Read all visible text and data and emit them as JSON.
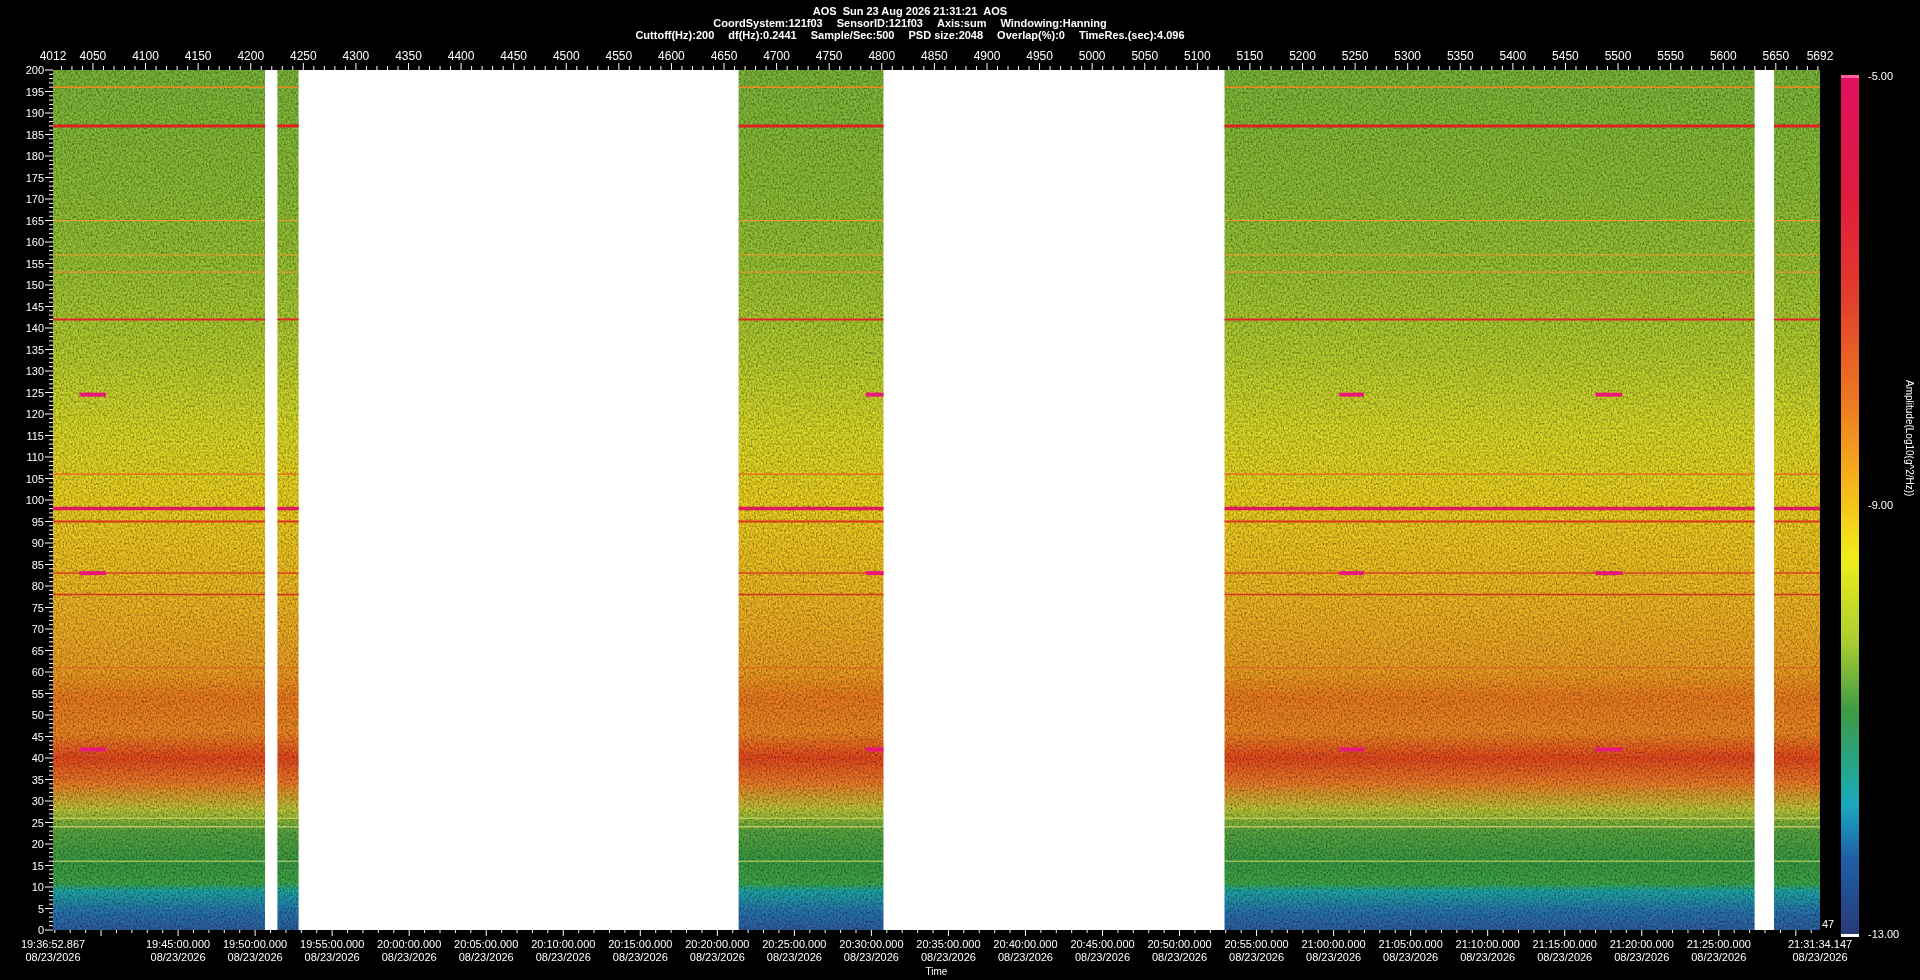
{
  "header": {
    "title": [
      "AOS",
      "Sun 23 Aug 2026 21:31:21",
      "AOS"
    ],
    "lines": [
      [
        "CoordSystem:121f03",
        "SensorID:121f03",
        "Axis:sum",
        "Windowing:Hanning"
      ],
      [
        "Cuttoff(Hz):200",
        "df(Hz):0.2441",
        "Sample/Sec:500",
        "PSD size:2048",
        "Overlap(%):0",
        "TimeRes.(sec):4.096"
      ]
    ]
  },
  "top_axis": {
    "ticks": [
      "4012",
      "4050",
      "4100",
      "4150",
      "4200",
      "4250",
      "4300",
      "4350",
      "4400",
      "4450",
      "4500",
      "4550",
      "4600",
      "4650",
      "4700",
      "4750",
      "4800",
      "4850",
      "4900",
      "4950",
      "5000",
      "5050",
      "5100",
      "5150",
      "5200",
      "5250",
      "5300",
      "5350",
      "5400",
      "5450",
      "5500",
      "5550",
      "5600",
      "5650",
      "5692"
    ]
  },
  "y_axis": {
    "ticks": [
      "200",
      "195",
      "190",
      "185",
      "180",
      "175",
      "170",
      "165",
      "160",
      "155",
      "150",
      "145",
      "140",
      "135",
      "130",
      "125",
      "120",
      "115",
      "110",
      "105",
      "100",
      "95",
      "90",
      "85",
      "80",
      "75",
      "70",
      "65",
      "60",
      "55",
      "50",
      "45",
      "40",
      "35",
      "30",
      "25",
      "20",
      "15",
      "10",
      "5",
      "0"
    ]
  },
  "x_axis": {
    "title": "Time",
    "ticks": [
      {
        "time": "19:36:52.867",
        "date": "08/23/2026"
      },
      {
        "time": "19:45:00.000",
        "date": "08/23/2026"
      },
      {
        "time": "19:50:00.000",
        "date": "08/23/2026"
      },
      {
        "time": "19:55:00.000",
        "date": "08/23/2026"
      },
      {
        "time": "20:00:00.000",
        "date": "08/23/2026"
      },
      {
        "time": "20:05:00.000",
        "date": "08/23/2026"
      },
      {
        "time": "20:10:00.000",
        "date": "08/23/2026"
      },
      {
        "time": "20:15:00.000",
        "date": "08/23/2026"
      },
      {
        "time": "20:20:00.000",
        "date": "08/23/2026"
      },
      {
        "time": "20:25:00.000",
        "date": "08/23/2026"
      },
      {
        "time": "20:30:00.000",
        "date": "08/23/2026"
      },
      {
        "time": "20:35:00.000",
        "date": "08/23/2026"
      },
      {
        "time": "20:40:00.000",
        "date": "08/23/2026"
      },
      {
        "time": "20:45:00.000",
        "date": "08/23/2026"
      },
      {
        "time": "20:50:00.000",
        "date": "08/23/2026"
      },
      {
        "time": "20:55:00.000",
        "date": "08/23/2026"
      },
      {
        "time": "21:00:00.000",
        "date": "08/23/2026"
      },
      {
        "time": "21:05:00.000",
        "date": "08/23/2026"
      },
      {
        "time": "21:10:00.000",
        "date": "08/23/2026"
      },
      {
        "time": "21:15:00.000",
        "date": "08/23/2026"
      },
      {
        "time": "21:20:00.000",
        "date": "08/23/2026"
      },
      {
        "time": "21:25:00.000",
        "date": "08/23/2026"
      },
      {
        "time": "21:31:34.147",
        "date": "08/23/2026"
      }
    ]
  },
  "colorbar": {
    "title": "Amplitude(Log10(g^2/Hz))",
    "labels": [
      "-5.00",
      "-9.00",
      "-13.00"
    ],
    "corner_text": "47"
  }
}
